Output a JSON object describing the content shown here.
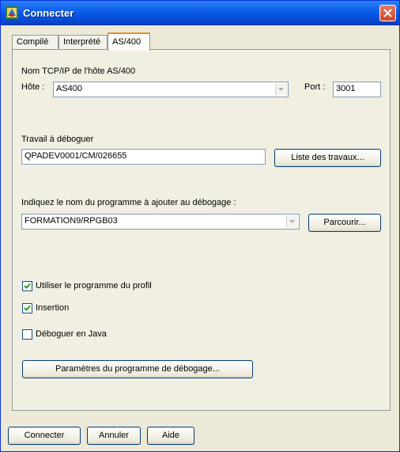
{
  "window": {
    "title": "Connecter"
  },
  "tabs": [
    {
      "label": "Compilé",
      "active": false
    },
    {
      "label": "Interprété",
      "active": false
    },
    {
      "label": "AS/400",
      "active": true
    }
  ],
  "host": {
    "section_label": "Nom TCP/IP de l'hôte AS/400",
    "host_label": "Hôte :",
    "host_value": "AS400",
    "port_label": "Port :",
    "port_value": "3001"
  },
  "job": {
    "label": "Travail à déboguer",
    "value": "QPADEV0001/CM/026655",
    "list_button": "Liste des travaux..."
  },
  "program": {
    "label": "Indiquez le nom du programme à ajouter au débogage :",
    "value": "FORMATION9/RPGB03",
    "browse_button": "Parcourir..."
  },
  "options": [
    {
      "label": "Utiliser le programme du profil",
      "checked": true
    },
    {
      "label": "Insertion",
      "checked": true
    },
    {
      "label": "Déboguer en Java",
      "checked": false
    }
  ],
  "params_button": "Paramètres du programme de débogage...",
  "footer": {
    "connect": "Connecter",
    "cancel": "Annuler",
    "help": "Aide"
  },
  "colors": {
    "titlebar": "#0a5de8",
    "dialog_bg": "#ece9d8",
    "tab_accent": "#e68b2c"
  }
}
